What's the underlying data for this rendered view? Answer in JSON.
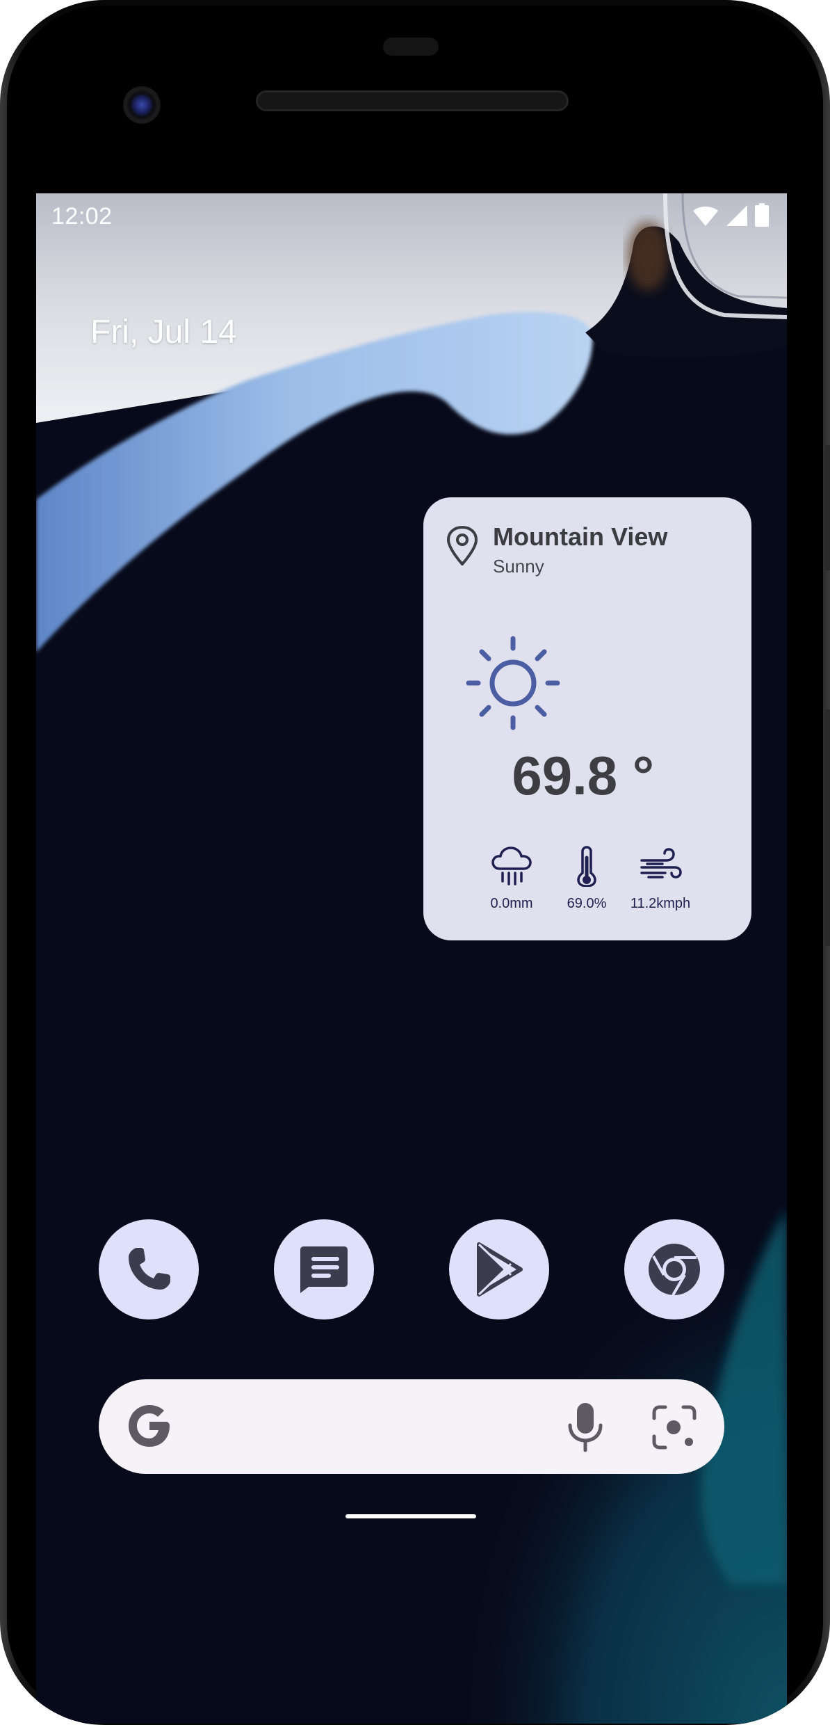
{
  "status_bar": {
    "time": "12:02",
    "icons": [
      "wifi-icon",
      "cellular-signal-icon",
      "battery-icon"
    ]
  },
  "home": {
    "date": "Fri, Jul 14"
  },
  "weather_widget": {
    "location": "Mountain View",
    "condition": "Sunny",
    "condition_icon": "sun-icon",
    "temperature": "69.8 °",
    "metrics": [
      {
        "icon": "rain-cloud-icon",
        "value": "0.0mm"
      },
      {
        "icon": "thermometer-icon",
        "value": "69.0%"
      },
      {
        "icon": "wind-icon",
        "value": "11.2kmph"
      }
    ]
  },
  "dock": {
    "apps": [
      {
        "name": "Phone",
        "icon": "phone-icon"
      },
      {
        "name": "Messages",
        "icon": "messages-icon"
      },
      {
        "name": "Play Store",
        "icon": "play-store-icon"
      },
      {
        "name": "Chrome",
        "icon": "chrome-icon"
      }
    ]
  },
  "search_bar": {
    "icons": [
      "google-logo-icon",
      "microphone-icon",
      "lens-icon"
    ]
  },
  "colors": {
    "widget_background": "#e1e0ee",
    "sun_accent": "#4b5ea3",
    "app_icon_background": "#dfe0fb",
    "search_bar_background": "#f5f2f8"
  }
}
